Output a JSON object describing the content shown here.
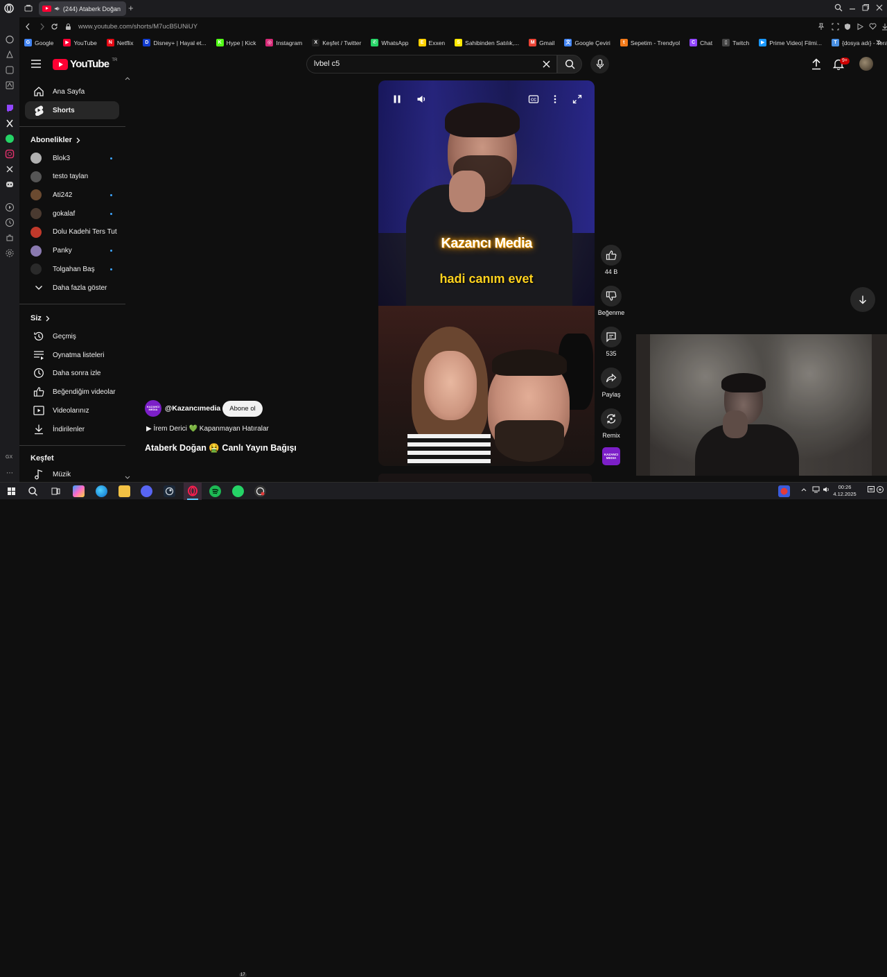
{
  "browser": {
    "tab_title": "(244) Ataberk Doğan",
    "url": "www.youtube.com/shorts/M7ucB5UNiUY",
    "bookmarks": [
      {
        "label": "Google",
        "color": "#4285f4",
        "glyph": "G"
      },
      {
        "label": "YouTube",
        "color": "#ff0033",
        "glyph": "▶"
      },
      {
        "label": "Netflix",
        "color": "#e50914",
        "glyph": "N"
      },
      {
        "label": "Disney+ | Hayal et...",
        "color": "#113ccf",
        "glyph": "D"
      },
      {
        "label": "Hype | Kick",
        "color": "#53fc18",
        "glyph": "K"
      },
      {
        "label": "Instagram",
        "color": "#d62976",
        "glyph": "◎"
      },
      {
        "label": "Keşfet / Twitter",
        "color": "#222222",
        "glyph": "X"
      },
      {
        "label": "WhatsApp",
        "color": "#25d366",
        "glyph": "✆"
      },
      {
        "label": "Exxen",
        "color": "#ffd100",
        "glyph": "E"
      },
      {
        "label": "Sahibinden Satılık,...",
        "color": "#ffe800",
        "glyph": "S"
      },
      {
        "label": "Gmail",
        "color": "#ea4335",
        "glyph": "M"
      },
      {
        "label": "Google Çeviri",
        "color": "#4285f4",
        "glyph": "文"
      },
      {
        "label": "Sepetim - Trendyol",
        "color": "#f27a1a",
        "glyph": "t"
      },
      {
        "label": "Chat",
        "color": "#9146ff",
        "glyph": "C"
      },
      {
        "label": "Twitch",
        "color": "#444444",
        "glyph": "▯"
      },
      {
        "label": "Prime Video| Filmi...",
        "color": "#1a98ff",
        "glyph": "▶"
      },
      {
        "label": "{dosya adı} - Tera...",
        "color": "#4a90e2",
        "glyph": "T"
      }
    ]
  },
  "youtube": {
    "logo_text": "YouTube",
    "logo_sup": "TR",
    "search_value": "lvbel c5",
    "notification_count": "9+",
    "sidebar": {
      "main": [
        {
          "label": "Ana Sayfa",
          "icon": "home-icon"
        },
        {
          "label": "Shorts",
          "icon": "shorts-icon"
        }
      ],
      "subscriptions_title": "Abonelikler",
      "subscriptions": [
        {
          "label": "Blok3",
          "color": "#b0b0b0",
          "new": true
        },
        {
          "label": "testo taylan",
          "color": "#555555",
          "new": false
        },
        {
          "label": "Ati242",
          "color": "#6a4a30",
          "new": true
        },
        {
          "label": "gokalaf",
          "color": "#4a3a30",
          "new": true
        },
        {
          "label": "Dolu Kadehi Ters Tut",
          "color": "#c0392b",
          "new": false
        },
        {
          "label": "Panky",
          "color": "#8a7ab0",
          "new": true
        },
        {
          "label": "Tolgahan Baş",
          "color": "#2a2a2a",
          "new": true
        }
      ],
      "show_more": "Daha fazla göster",
      "you_title": "Siz",
      "you_items": [
        {
          "label": "Geçmiş",
          "icon": "history-icon"
        },
        {
          "label": "Oynatma listeleri",
          "icon": "playlist-icon"
        },
        {
          "label": "Daha sonra izle",
          "icon": "watch-later-icon"
        },
        {
          "label": "Beğendiğim videolar",
          "icon": "liked-icon"
        },
        {
          "label": "Videolarınız",
          "icon": "your-videos-icon"
        },
        {
          "label": "İndirilenler",
          "icon": "download-icon"
        }
      ],
      "explore_title": "Keşfet",
      "explore_items": [
        {
          "label": "Müzik",
          "icon": "music-icon"
        }
      ]
    },
    "short": {
      "caption_brand": "Kazancı Media",
      "caption_text": "hadi canım evet",
      "channel_handle": "@Kazancımedia",
      "channel_avatar_text": "KAZANCI MEDIA",
      "subscribe_label": "Abone ol",
      "music": "İrem Derici 💚 Kapanmayan Hatıralar",
      "title": "Ataberk Doğan 🤮 Canlı Yayın Bağışı",
      "likes": "44 B",
      "dislike_label": "Beğenme",
      "comments": "535",
      "share_label": "Paylaş",
      "remix_label": "Remix"
    }
  },
  "taskbar": {
    "time": "00:26",
    "date": "4.12.2025",
    "whatsapp_badge": "17",
    "gx_label": "GX"
  }
}
